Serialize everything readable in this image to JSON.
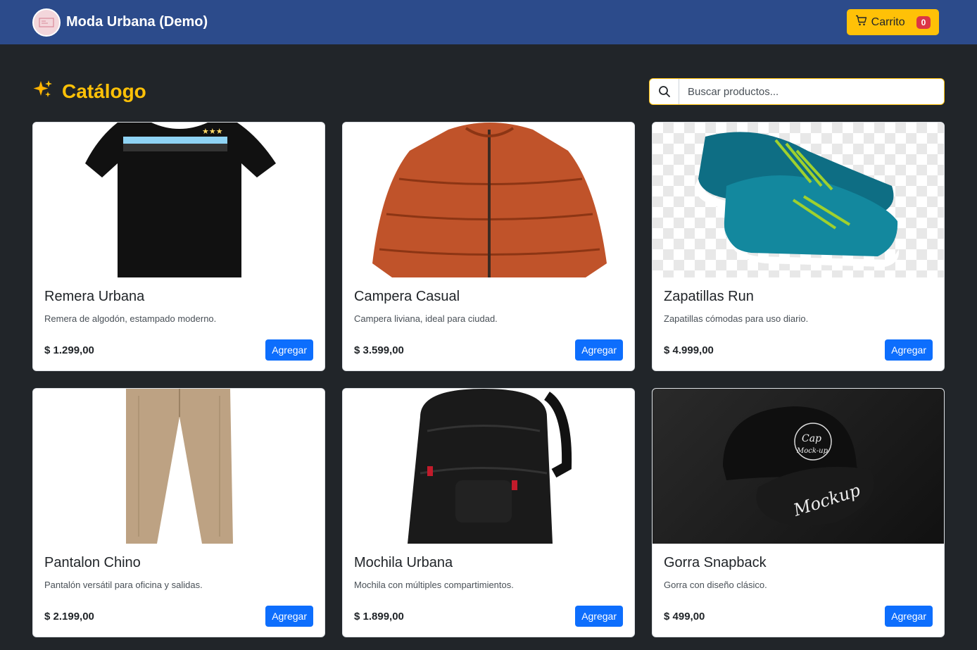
{
  "navbar": {
    "brand_title": "Moda Urbana (Demo)",
    "cart_label": "Carrito",
    "cart_count": "0"
  },
  "catalog": {
    "title": "Catálogo",
    "title_icon": "sparkles-icon"
  },
  "search": {
    "placeholder": "Buscar productos..."
  },
  "products": [
    {
      "name": "Remera Urbana",
      "description": "Remera de algodón, estampado moderno.",
      "price": "$ 1.299,00",
      "button": "Agregar",
      "image": "tshirt"
    },
    {
      "name": "Campera Casual",
      "description": "Campera liviana, ideal para ciudad.",
      "price": "$ 3.599,00",
      "button": "Agregar",
      "image": "jacket"
    },
    {
      "name": "Zapatillas Run",
      "description": "Zapatillas cómodas para uso diario.",
      "price": "$ 4.999,00",
      "button": "Agregar",
      "image": "sneakers"
    },
    {
      "name": "Pantalon Chino",
      "description": "Pantalón versátil para oficina y salidas.",
      "price": "$ 2.199,00",
      "button": "Agregar",
      "image": "pants"
    },
    {
      "name": "Mochila Urbana",
      "description": "Mochila con múltiples compartimientos.",
      "price": "$ 1.899,00",
      "button": "Agregar",
      "image": "backpack"
    },
    {
      "name": "Gorra Snapback",
      "description": "Gorra con diseño clásico.",
      "price": "$ 499,00",
      "button": "Agregar",
      "image": "cap",
      "image_text": [
        "Cap",
        "Mock-up",
        "Mockup"
      ]
    }
  ],
  "colors": {
    "navbar": "#2c4b8b",
    "accent": "#ffc107",
    "primary": "#0d6efd",
    "badge": "#dc3545",
    "page_bg": "#212529"
  }
}
